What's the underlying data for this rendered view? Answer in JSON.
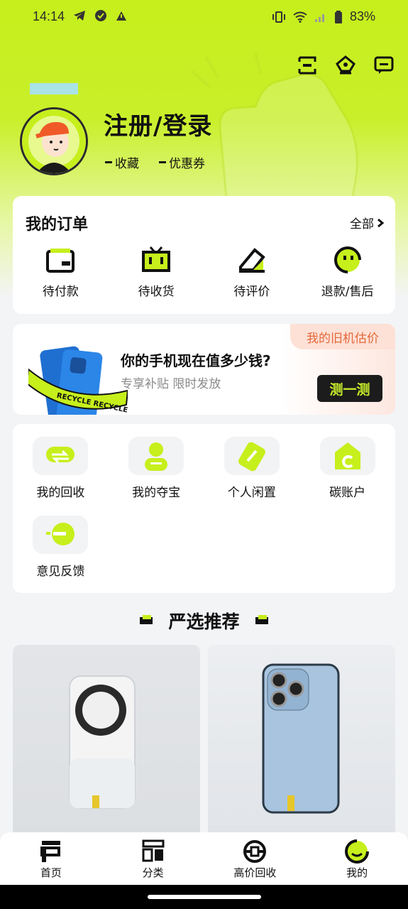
{
  "status_bar": {
    "time": "14:14",
    "battery": "83%",
    "icons": [
      "telegram-icon",
      "check-badge-icon",
      "alert-icon",
      "vibrate-icon",
      "wifi-icon",
      "signal-icon",
      "battery-icon"
    ]
  },
  "header": {
    "actions": [
      "scan-icon",
      "service-icon",
      "message-icon"
    ],
    "login_label": "注册/登录",
    "favorites_label": "收藏",
    "coupons_label": "优惠券"
  },
  "orders": {
    "title": "我的订单",
    "all_label": "全部",
    "items": [
      {
        "label": "待付款",
        "icon": "wallet-icon"
      },
      {
        "label": "待收货",
        "icon": "tv-box-icon"
      },
      {
        "label": "待评价",
        "icon": "pencil-icon"
      },
      {
        "label": "退款/售后",
        "icon": "smiley-icon"
      }
    ]
  },
  "recycle_banner": {
    "badge": "我的旧机估价",
    "headline": "你的手机现在值多少钱?",
    "subline": "专享补贴 限时发放",
    "button": "测一测",
    "ribbon_text": "RECYCLE RECYCLE RE"
  },
  "services": [
    {
      "label": "我的回收",
      "icon": "recycle-exchange-icon"
    },
    {
      "label": "我的夺宝",
      "icon": "treasure-icon"
    },
    {
      "label": "个人闲置",
      "icon": "tag-icon"
    },
    {
      "label": "碳账户",
      "icon": "carbon-house-icon"
    },
    {
      "label": "意见反馈",
      "icon": "feedback-bubble-icon"
    }
  ],
  "recommend": {
    "title": "严选推荐"
  },
  "tabbar": [
    {
      "label": "首页",
      "icon": "home-p-icon"
    },
    {
      "label": "分类",
      "icon": "category-icon"
    },
    {
      "label": "高价回收",
      "icon": "recycle-coin-icon"
    },
    {
      "label": "我的",
      "icon": "profile-icon"
    }
  ],
  "colors": {
    "accent": "#c6ef1c",
    "dark": "#1c1c1c",
    "badge_text": "#e4683a"
  }
}
